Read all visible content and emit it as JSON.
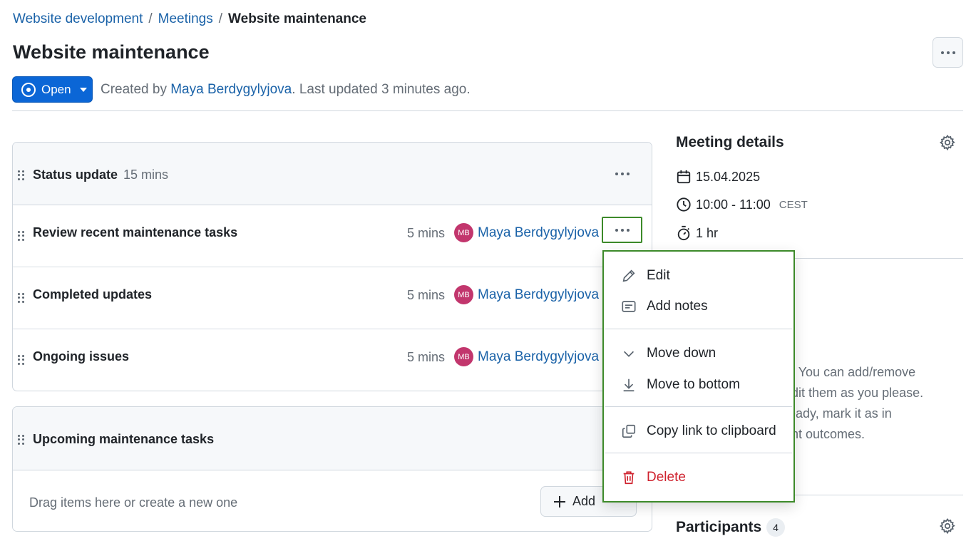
{
  "breadcrumb": {
    "items": [
      "Website development",
      "Meetings"
    ],
    "separator": "/",
    "current": "Website maintenance"
  },
  "page": {
    "title": "Website maintenance",
    "status_label": "Open",
    "meta_prefix": "Created by ",
    "author": "Maya Berdygylyjova",
    "meta_suffix": ". Last updated 3 minutes ago."
  },
  "sections": [
    {
      "title": "Status update",
      "duration": "15 mins",
      "items": [
        {
          "title": "Review recent maintenance tasks",
          "duration": "5 mins",
          "initials": "MB",
          "owner": "Maya Berdygylyjova"
        },
        {
          "title": "Completed updates",
          "duration": "5 mins",
          "initials": "MB",
          "owner": "Maya Berdygylyjova"
        },
        {
          "title": "Ongoing issues",
          "duration": "5 mins",
          "initials": "MB",
          "owner": "Maya Berdygylyjova"
        }
      ]
    },
    {
      "title": "Upcoming maintenance tasks",
      "empty_text": "Drag items here or create a new one",
      "add_label": "Add"
    }
  ],
  "meeting_details": {
    "title": "Meeting details",
    "date": "15.04.2025",
    "time": "10:00 - 11:00",
    "timezone": "CEST",
    "duration": "1 hr"
  },
  "side_text_lines": [
    "n. You can add/remove",
    "edit them as you please.",
    "ready, mark it as in",
    "ent outcomes."
  ],
  "participants": {
    "title": "Participants",
    "count": "4"
  },
  "dropdown": {
    "edit": "Edit",
    "add_notes": "Add notes",
    "move_down": "Move down",
    "move_to_bottom": "Move to bottom",
    "copy_link": "Copy link to clipboard",
    "delete": "Delete"
  },
  "colors": {
    "primary": "#0b66d6",
    "link": "#1a62a8",
    "avatar": "#c2366d",
    "danger": "#cf222e",
    "highlight": "#3d8a2a"
  }
}
